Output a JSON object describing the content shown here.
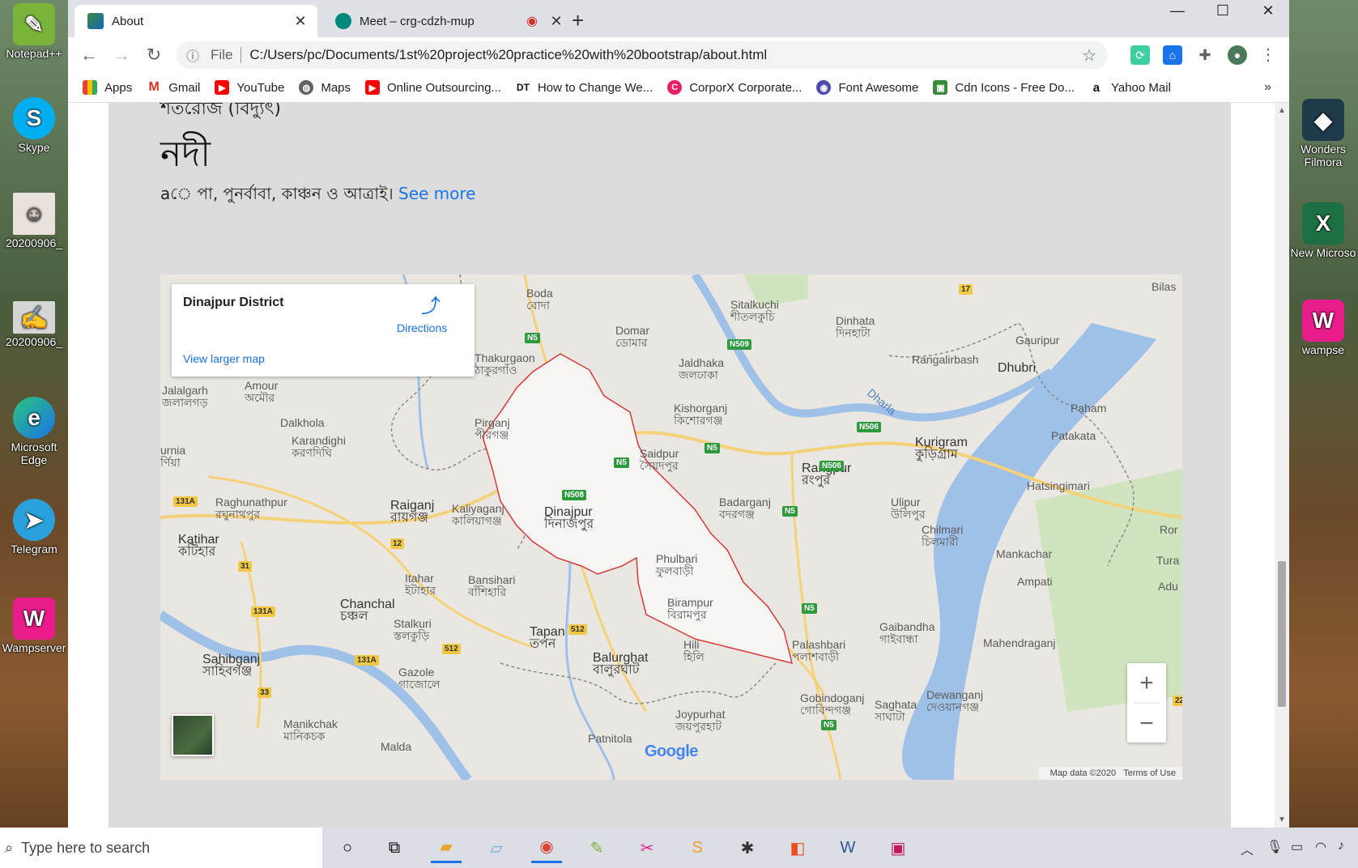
{
  "desktop": {
    "left_icons": [
      "Notepad++",
      "Skype",
      "20200906_",
      "20200906_",
      "Microsoft Edge",
      "Telegram",
      "Wampserver"
    ],
    "right_icons": [
      "Wonders Filmora",
      "New Microso",
      "wampse"
    ]
  },
  "browser": {
    "tabs": [
      {
        "title": "About",
        "active": true
      },
      {
        "title": "Meet – crg-cdzh-mup",
        "active": false
      }
    ],
    "address": {
      "scheme_label": "File",
      "url": "C:/Users/pc/Documents/1st%20project%20practice%20with%20bootstrap/about.html"
    },
    "bookmarks": [
      "Apps",
      "Gmail",
      "YouTube",
      "Maps",
      "Online Outsourcing...",
      "How to Change We...",
      "CorporX Corporate...",
      "Font Awesome",
      "Cdn Icons - Free Do...",
      "Yahoo Mail"
    ],
    "more_bookmarks": "»"
  },
  "page": {
    "cut_text": "শতরোজ (বিদ্যুৎ)",
    "heading": "নদী",
    "paragraph": "aে পা, পুনর্বাবা, কাঞ্চন ও আত্রাই।",
    "see_more": "See more"
  },
  "map": {
    "place_name": "Dinajpur District",
    "directions": "Directions",
    "view_larger": "View larger map",
    "attribution": "Map data ©2020",
    "terms": "Terms of Use",
    "logo": "Google",
    "zoom_in": "+",
    "zoom_out": "−",
    "labels": {
      "dinajpur": "Dinajpur",
      "dinajpur_bn": "দিনাজপুর",
      "thakurgaon": "Thakurgaon",
      "thakurgaon_bn": "ঠাকুরগাঁও",
      "boda": "Boda",
      "boda_bn": "বোদা",
      "domar": "Domar",
      "domar_bn": "ডোমার",
      "sitalkuchi": "Sitalkuchi",
      "sitalkuchi_bn": "শীতলকুচি",
      "dinhata": "Dinhata",
      "dinhata_bn": "দিনহাটা",
      "jaldhaka": "Jaldhaka",
      "jaldhaka_bn": "জলঢাকা",
      "kishorganj": "Kishorganj",
      "kishorganj_bn": "কিশোরগঞ্জ",
      "saidpur": "Saidpur",
      "saidpur_bn": "সৈয়দপুর",
      "rangpur": "Rangpur",
      "rangpur_bn": "রংপুর",
      "kurigram": "Kurigram",
      "kurigram_bn": "কুড়িগ্রাম",
      "dhubri": "Dhubri",
      "gauripur": "Gauripur",
      "rangalirbash": "Rangalirbash",
      "paham": "Paham",
      "patakata": "Patakata",
      "hatsingimari": "Hatsingimari",
      "jalalgarh": "Jalalgarh",
      "jalalgarh_bn": "জলালগড়",
      "amour": "Amour",
      "amour_bn": "অমৌর",
      "dalkhola": "Dalkhola",
      "karandighi": "Karandighi",
      "karandighi_bn": "করণদিঘি",
      "pirganj": "Pirganj",
      "pirganj_bn": "পীরগঞ্জ",
      "badarganj": "Badarganj",
      "badarganj_bn": "বদরগঞ্জ",
      "raghunathpur": "Raghunathpur",
      "raghunathpur_bn": "রঘুনাথপুর",
      "raiganj": "Raiganj",
      "raiganj_bn": "রায়গঞ্জ",
      "kaliyaganj": "Kaliyaganj",
      "kaliyaganj_bn": "কালিয়াগঞ্জ",
      "katihar": "Katihar",
      "katihar_bn": "কটিহার",
      "itahar": "Itahar",
      "itahar_bn": "ইটাহার",
      "bansihari": "Bansihari",
      "bansihari_bn": "বাঁশিহারি",
      "phulbari": "Phulbari",
      "phulbari_bn": "ফুলবাড়ী",
      "birampur": "Birampur",
      "birampur_bn": "বিরামপুর",
      "hili": "Hili",
      "hili_bn": "হিলি",
      "ulipur": "Ulipur",
      "ulipur_bn": "উলিপুর",
      "chilmari": "Chilmari",
      "chilmari_bn": "চিলমারী",
      "mankachar": "Mankachar",
      "ampati": "Ampati",
      "chanchal": "Chanchal",
      "chanchal_bn": "চঞ্চল",
      "stalkuri": "Stalkuri",
      "stalkuri_bn": "স্তলকুড়ি",
      "tapan": "Tapan",
      "tapan_bn": "তপন",
      "balurghat": "Balurghat",
      "balurghat_bn": "বালুরঘাট",
      "gaibandha": "Gaibandha",
      "gaibandha_bn": "গাইবান্ধা",
      "palashbari": "Palashbari",
      "palashbari_bn": "পলাশবাড়ী",
      "mahendraganj": "Mahendraganj",
      "sahibganj": "Sahibganj",
      "sahibganj_bn": "সাহিবগঞ্জ",
      "gazole": "Gazole",
      "gazole_bn": "গাজোলে",
      "gobindoganj": "Gobindoganj",
      "gobindoganj_bn": "গোবিন্দগঞ্জ",
      "saghata": "Saghata",
      "saghata_bn": "সাঘাটা",
      "dewanganj": "Dewanganj",
      "dewanganj_bn": "দেওয়ানগঞ্জ",
      "manikchak": "Manikchak",
      "manikchak_bn": "মানিকচক",
      "joypurhat": "Joypurhat",
      "joypurhat_bn": "জয়পুরহাট",
      "patnitola": "Patnitola",
      "malda": "Malda",
      "bilas": "Bilas",
      "ror": "Ror",
      "tura": "Tura",
      "adu": "Adu",
      "dharla": "Dharla",
      "urnia": "urnia",
      "urnia_bn": "র্ণিয়া"
    },
    "shields": [
      "N5",
      "N509",
      "N506",
      "N506",
      "N5",
      "N5",
      "N508",
      "N5",
      "N5",
      "N5",
      "131A",
      "131A",
      "131A",
      "12",
      "31",
      "33",
      "512",
      "512",
      "17",
      "N5",
      "22"
    ]
  },
  "taskbar": {
    "search_placeholder": "Type here to search"
  },
  "colors": {
    "accent": "#1a73e8",
    "district_border": "#d33a3a",
    "water": "#9fc1e8",
    "road_major": "#f3d27a"
  }
}
